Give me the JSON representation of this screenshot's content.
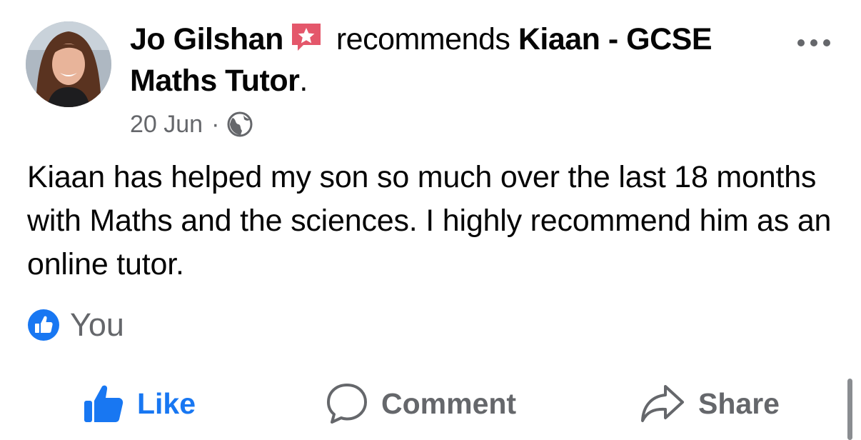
{
  "post": {
    "author": "Jo Gilshan",
    "verb": "recommends",
    "page_name": "Kiaan - GCSE Maths Tutor",
    "page_suffix": ".",
    "date": "20 Jun",
    "separator": "·",
    "privacy_icon": "globe-icon",
    "recommend_icon": "recommend-star-icon",
    "more_icon": "more-options-icon",
    "body_text": "Kiaan has helped my son so much over the last 18 months with Maths and the sciences. I highly recommend him as an online tutor."
  },
  "reactions": {
    "icon": "like-badge-icon",
    "names": "You"
  },
  "actions": {
    "like": {
      "label": "Like",
      "icon": "thumbs-up-icon"
    },
    "comment": {
      "label": "Comment",
      "icon": "comment-bubble-icon"
    },
    "share": {
      "label": "Share",
      "icon": "share-arrow-icon"
    }
  },
  "colors": {
    "brand_blue": "#1877f2",
    "recommend_red": "#e4576b",
    "secondary_text": "#65676b",
    "primary_text": "#050505"
  }
}
